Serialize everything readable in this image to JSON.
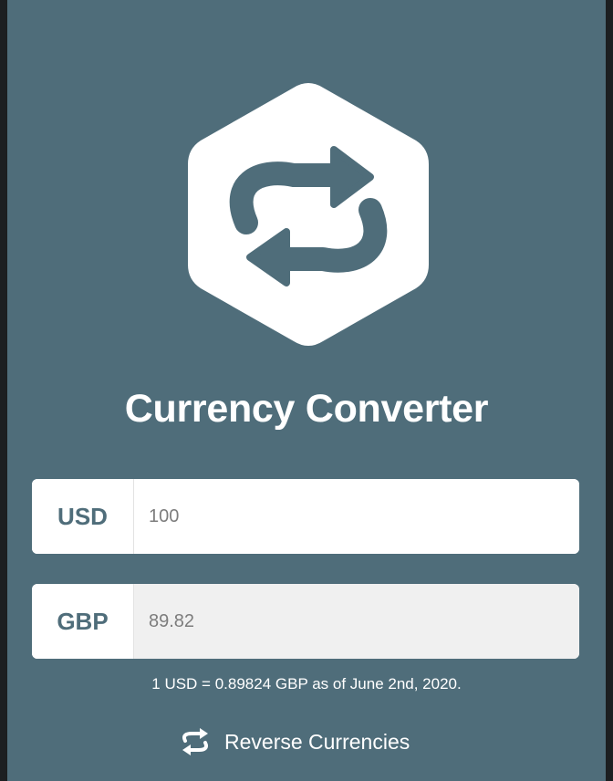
{
  "app": {
    "title": "Currency Converter",
    "logo_icon": "swap-arrows-icon",
    "colors": {
      "background": "#4f6d7a",
      "card": "#ffffff",
      "readonly_field": "#f0f0f0",
      "accent_text": "#4f6d7a"
    }
  },
  "base": {
    "currency": "USD",
    "amount": "100"
  },
  "quote": {
    "currency": "GBP",
    "amount": "89.82"
  },
  "rate_info": "1 USD = 0.89824 GBP as of June 2nd, 2020.",
  "reverse": {
    "label": "Reverse Currencies",
    "icon": "repeat-icon"
  }
}
